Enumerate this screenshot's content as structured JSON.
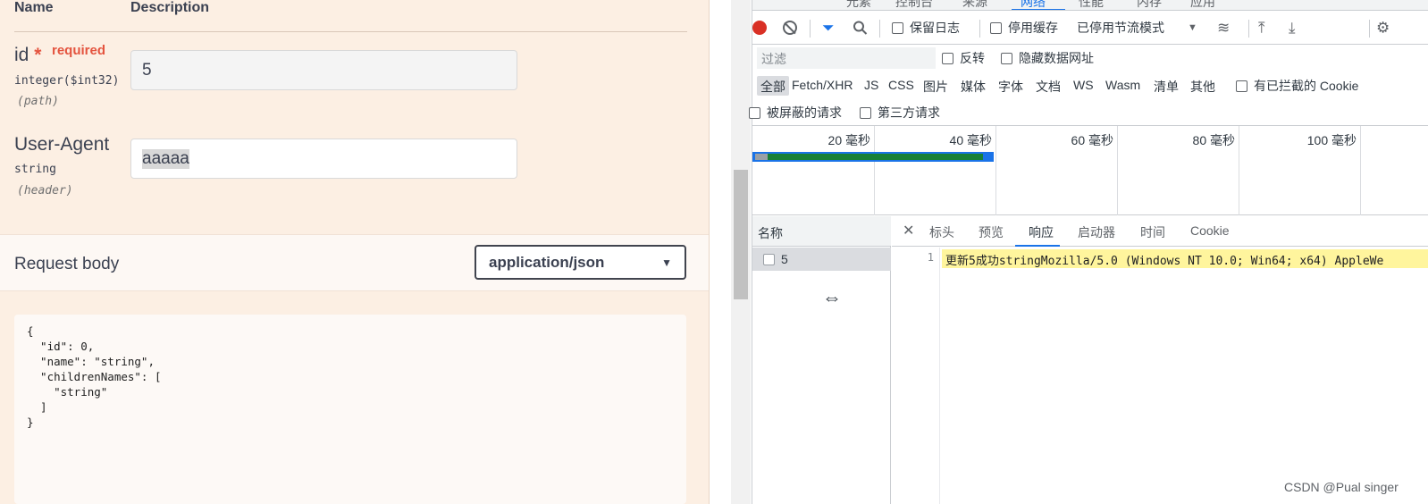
{
  "swagger": {
    "headers": {
      "name": "Name",
      "description": "Description"
    },
    "params": [
      {
        "name": "id",
        "required_mark": "*",
        "required_text": "required",
        "type": "integer($int32)",
        "in": "(path)",
        "value": "5"
      },
      {
        "name": "User-Agent",
        "type": "string",
        "in": "(header)",
        "value": "aaaaa"
      }
    ],
    "request_body": {
      "label": "Request body",
      "content_type": "application/json",
      "example": "{\n  \"id\": 0,\n  \"name\": \"string\",\n  \"childrenNames\": [\n    \"string\"\n  ]\n}"
    }
  },
  "devtools": {
    "top_tabs": [
      "元素",
      "控制台",
      "来源",
      "网络",
      "性能",
      "内存",
      "应用"
    ],
    "active_top_tab": "网络",
    "toolbar": {
      "preserve_log": "保留日志",
      "disable_cache": "停用缓存",
      "throttling": "已停用节流模式"
    },
    "filter": {
      "placeholder": "过滤",
      "invert": "反转",
      "hide_data_urls": "隐藏数据网址"
    },
    "type_filters": [
      "全部",
      "Fetch/XHR",
      "JS",
      "CSS",
      "图片",
      "媒体",
      "字体",
      "文档",
      "WS",
      "Wasm",
      "清单",
      "其他"
    ],
    "active_type": "全部",
    "blocked_cookies": "有已拦截的 Cookie",
    "blocked_requests": "被屏蔽的请求",
    "third_party": "第三方请求",
    "timeline_labels": [
      "20 毫秒",
      "40 毫秒",
      "60 毫秒",
      "80 毫秒",
      "100 毫秒"
    ],
    "requests_header": "名称",
    "requests": [
      {
        "name": "5"
      }
    ],
    "detail_tabs": [
      "标头",
      "预览",
      "响应",
      "启动器",
      "时间",
      "Cookie"
    ],
    "active_detail_tab": "响应",
    "response": {
      "line_number": "1",
      "text": "更新5成功stringMozilla/5.0 (Windows NT 10.0; Win64; x64) AppleWe"
    }
  },
  "watermark": "CSDN @Pual singer",
  "colors": {
    "record": "#d93025",
    "accent": "#1a73e8",
    "required": "#e4543f",
    "response_highlight": "#fff59d"
  }
}
